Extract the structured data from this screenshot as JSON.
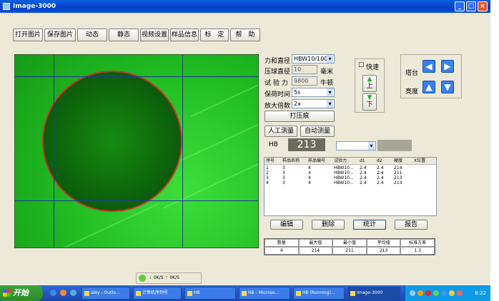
{
  "window": {
    "title": "Image-3000",
    "min": "_",
    "max": "□",
    "close": "×"
  },
  "toolbar": [
    "打开图片",
    "保存图片",
    "动态",
    "静态",
    "视频设置",
    "样品信息",
    "标　定",
    "帮　助"
  ],
  "params": {
    "force_diameter": {
      "label": "力和直径",
      "value": "HBW10/1000"
    },
    "ball_diameter": {
      "label": "压球直径",
      "value": "10",
      "unit": "毫米"
    },
    "test_force": {
      "label": "试 验 力",
      "value": "9800",
      "unit": "牛顿"
    },
    "hold_time": {
      "label": "保荷时间",
      "value": "5s"
    },
    "magnification": {
      "label": "放大倍数",
      "value": "2x"
    }
  },
  "speed": {
    "fast_label": "快速",
    "up_label": "上",
    "down_label": "下"
  },
  "platform": {
    "stage_label": "塔台",
    "brightness_label": "亮度"
  },
  "actions": {
    "indent": "打压痕",
    "manual": "人工测量",
    "auto": "自动测量"
  },
  "hb": {
    "label": "HB",
    "value": "213"
  },
  "table": {
    "headers": [
      "序号",
      "样品名称",
      "样品编号",
      "试验力",
      "d1",
      "d2",
      "硬度",
      "X位置"
    ],
    "rows": [
      [
        "1",
        "3",
        "4",
        "HBW10...",
        "2.4",
        "2.4",
        "214",
        ""
      ],
      [
        "2",
        "3",
        "4",
        "HBW10...",
        "2.4",
        "2.4",
        "211",
        ""
      ],
      [
        "3",
        "3",
        "4",
        "HBW10...",
        "2.4",
        "2.4",
        "213",
        ""
      ],
      [
        "4",
        "3",
        "4",
        "HBW10...",
        "2.4",
        "2.4",
        "213",
        ""
      ]
    ]
  },
  "bottom_buttons": {
    "edit": "编辑",
    "delete": "删除",
    "stats": "统计",
    "report": "报告"
  },
  "stats": {
    "headers": [
      "数量",
      "最大值",
      "最小值",
      "平均值",
      "标准方差"
    ],
    "values": [
      "4",
      "214",
      "211",
      "213",
      "1.3"
    ]
  },
  "netbar": {
    "down": "0K/S",
    "up": "0K/S"
  },
  "taskbar": {
    "start": "开始",
    "tasks": [
      "aley - Outlo...",
      "计算机序列号",
      "HB",
      "HB - Microso...",
      "HB (Running)...",
      "Image-3000"
    ],
    "clock": "8:22"
  }
}
